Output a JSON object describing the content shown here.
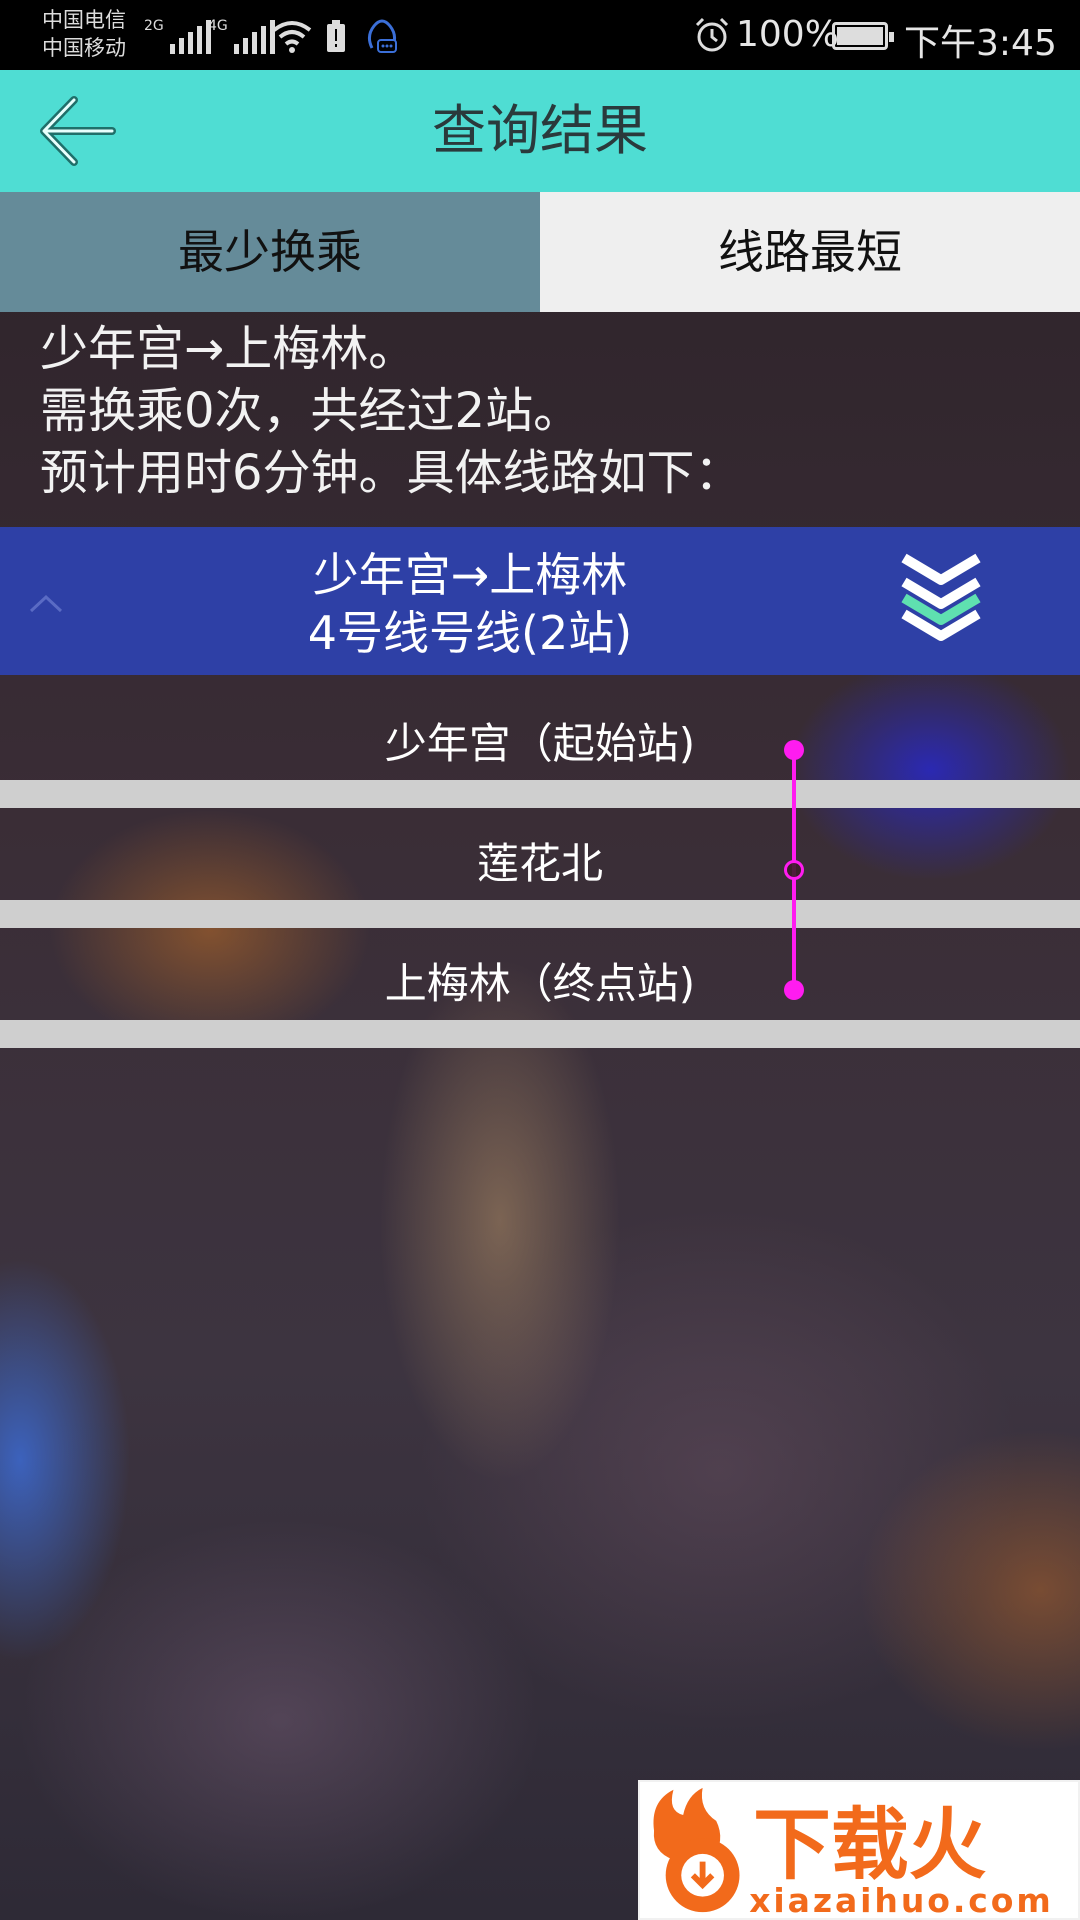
{
  "status_bar": {
    "carrier_1": "中国电信",
    "carrier_2": "中国移动",
    "signal_1_label": "2G",
    "signal_2_label": "4G",
    "battery_percent": "100%",
    "time": "下午3:45"
  },
  "header": {
    "title": "查询结果",
    "back_icon": "arrow-left-icon"
  },
  "tabs": [
    {
      "label": "最少换乘",
      "selected": true
    },
    {
      "label": "线路最短",
      "selected": false
    }
  ],
  "summary": {
    "line1": "少年宫→上梅林。",
    "line2": "需换乘0次，共经过2站。",
    "line3": "预计用时6分钟。具体线路如下："
  },
  "route": {
    "segment": "少年宫→上梅林",
    "line_info": "4号线号线(2站)",
    "collapse_icon": "chevron-up-icon",
    "line_icon": "layers-icon"
  },
  "stations": [
    {
      "name": "少年宫（起始站)",
      "marker": "filled"
    },
    {
      "name": "莲花北",
      "marker": "hollow"
    },
    {
      "name": "上梅林（终点站)",
      "marker": "filled"
    }
  ],
  "colors": {
    "header_bg": "#4fddd3",
    "tab_active_bg": "#658b99",
    "tab_inactive_bg": "#efefef",
    "route_header_bg": "#2e40a6",
    "route_line": "#ff1cf0"
  },
  "watermark": {
    "brand": "下载火",
    "url": "xiazaihuo.com"
  }
}
